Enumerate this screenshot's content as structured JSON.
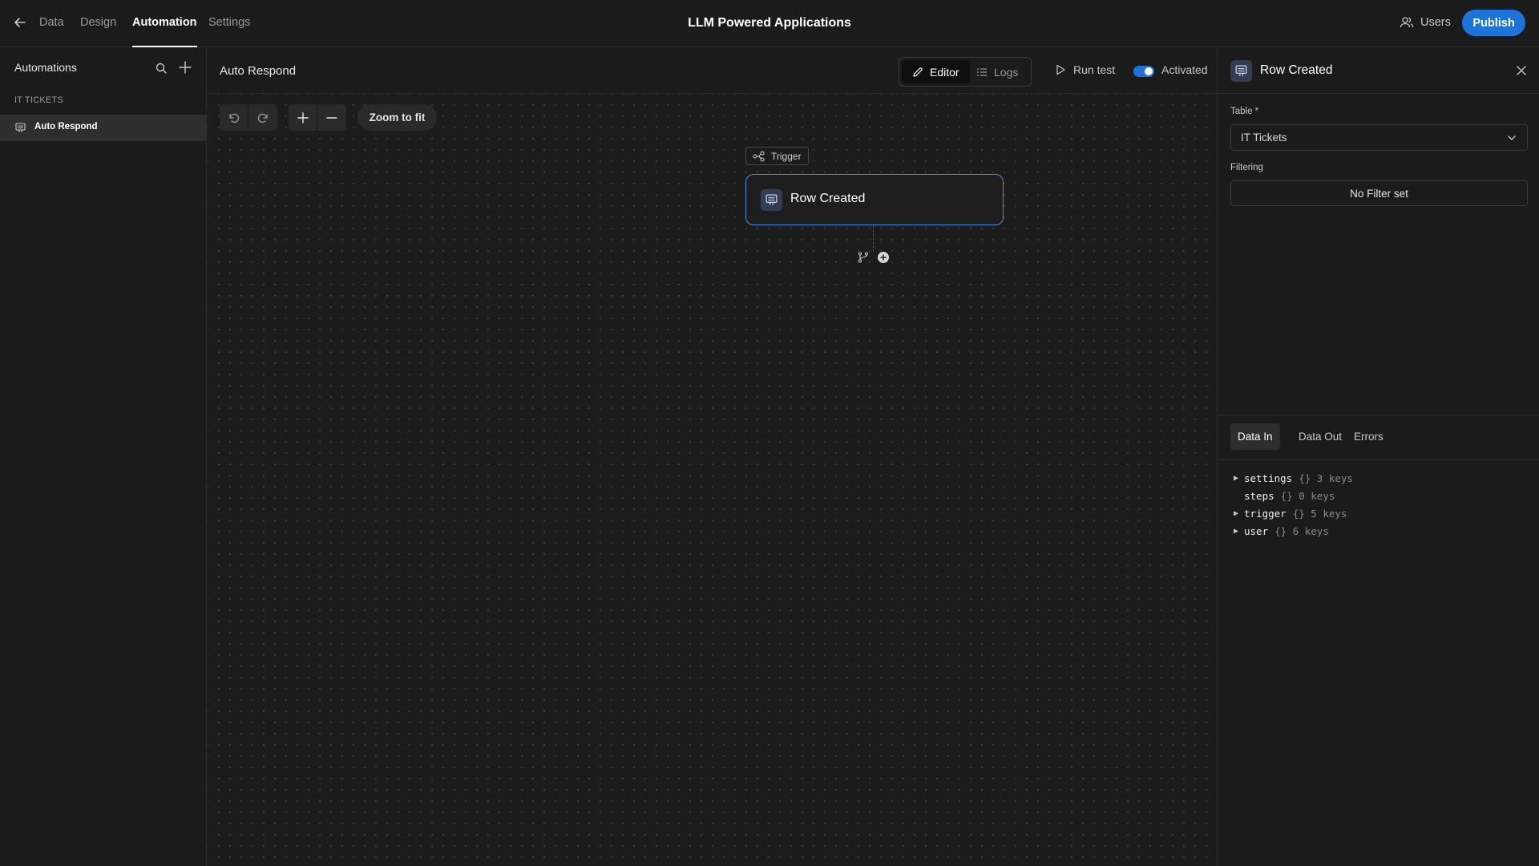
{
  "topbar": {
    "nav_tabs": [
      "Data",
      "Design",
      "Automation",
      "Settings"
    ],
    "app_title": "LLM Powered Applications",
    "users_label": "Users",
    "publish_label": "Publish"
  },
  "sidebar": {
    "title": "Automations",
    "group_label": "IT TICKETS",
    "items": [
      {
        "label": "Auto Respond",
        "selected": true
      }
    ]
  },
  "main": {
    "automation_name": "Auto Respond",
    "view_tabs": [
      "Editor",
      "Logs"
    ],
    "active_view": "Editor",
    "run_test_label": "Run test",
    "activated_label": "Activated",
    "activated": true
  },
  "canvas": {
    "zoom_fit_label": "Zoom to fit",
    "trigger_tag": "Trigger",
    "node_label": "Row Created"
  },
  "panel": {
    "title": "Row Created",
    "table_label": "Table *",
    "table_value": "IT Tickets",
    "filtering_label": "Filtering",
    "filter_value": "No Filter set",
    "data_tabs": [
      "Data In",
      "Data Out",
      "Errors"
    ],
    "active_data_tab": "Data In",
    "tree": [
      {
        "key": "settings",
        "meta": "{} 3 keys",
        "expandable": true
      },
      {
        "key": "steps",
        "meta": "{} 0 keys",
        "expandable": false
      },
      {
        "key": "trigger",
        "meta": "{} 5 keys",
        "expandable": true
      },
      {
        "key": "user",
        "meta": "{} 6 keys",
        "expandable": true
      }
    ]
  },
  "colors": {
    "accent": "#1d74d8",
    "node_border": "#4d8ed8",
    "background": "#1c1c1c"
  }
}
